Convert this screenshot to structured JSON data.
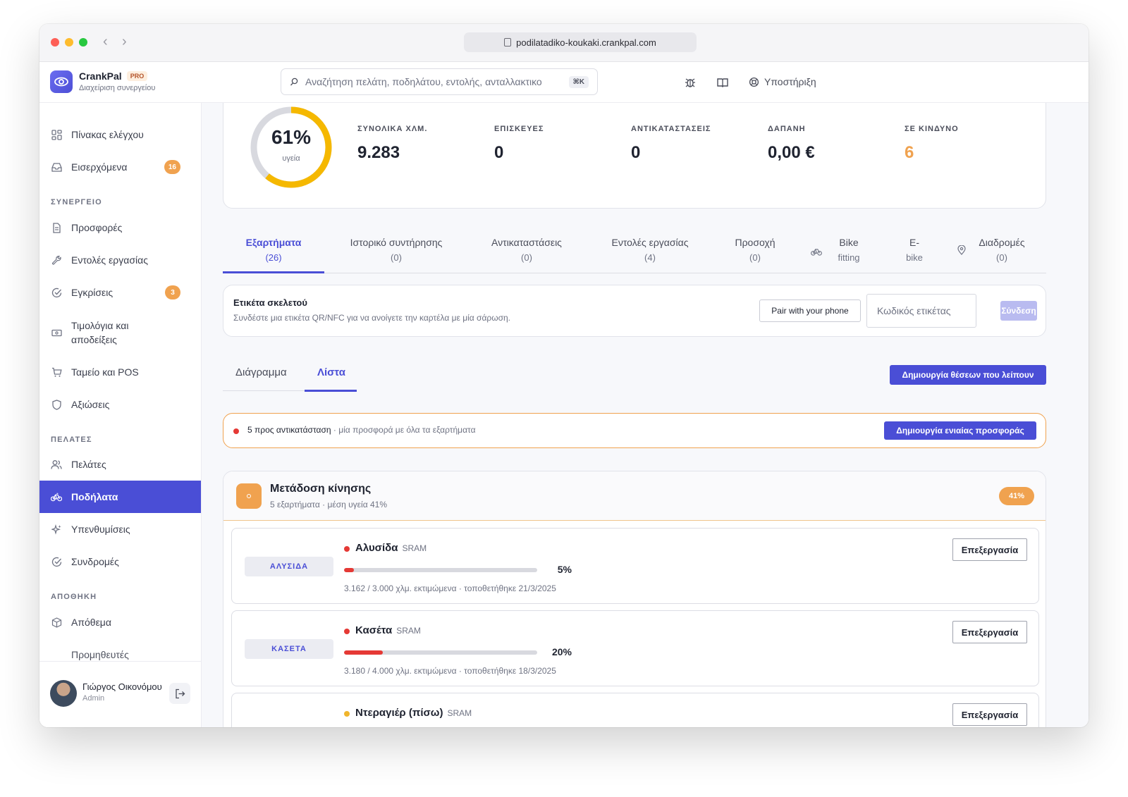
{
  "browser": {
    "url": "podilatadiko-koukaki.crankpal.com"
  },
  "app": {
    "name": "CrankPal",
    "badge": "PRO",
    "subtitle": "Διαχείριση συνεργείου"
  },
  "search": {
    "placeholder": "Αναζήτηση πελάτη, ποδηλάτου, εντολής, ανταλλακτικο",
    "shortcut": "⌘K"
  },
  "topbar": {
    "support_label": "Υποστήριξη"
  },
  "sidebar": {
    "dashboard": "Πίνακας ελέγχου",
    "inbox": "Εισερχόμενα",
    "inbox_count": "16",
    "section_workshop": "ΣΥΝΕΡΓΕΙΟ",
    "offers": "Προσφορές",
    "work_orders": "Εντολές εργασίας",
    "approvals": "Εγκρίσεις",
    "approvals_count": "3",
    "invoices": "Τιμολόγια και αποδείξεις",
    "pos": "Ταμείο και POS",
    "claims": "Αξιώσεις",
    "section_customers": "ΠΕΛΑΤΕΣ",
    "customers": "Πελάτες",
    "bikes": "Ποδήλατα",
    "reminders": "Υπενθυμίσεις",
    "subscriptions": "Συνδρομές",
    "section_storage": "ΑΠΟΘΗΚΗ",
    "stock": "Απόθεμα",
    "cut_off_item": "Προμηθευτές"
  },
  "user": {
    "name": "Γιώργος Οικονόμου",
    "role": "Admin"
  },
  "stats": {
    "health_pct": "61%",
    "health_value": 0.61,
    "health_label": "υγεία",
    "total_km_label": "ΣΥΝΟΛΙΚΑ ΧΛΜ.",
    "total_km": "9.283",
    "repairs_label": "ΕΠΙΣΚΕΥΕΣ",
    "repairs": "0",
    "replacements_label": "ΑΝΤΙΚΑΤΑΣΤΑΣΕΙΣ",
    "replacements": "0",
    "cost_label": "ΔΑΠΑΝΗ",
    "cost": "0,00 €",
    "risk_label": "ΣΕ ΚΙΝΔΥΝΟ",
    "risk": "6"
  },
  "tabs": {
    "components": "Εξαρτήματα",
    "components_count": "(26)",
    "history": "Ιστορικό συντήρησης",
    "history_count": "(0)",
    "replacements": "Αντικαταστάσεις",
    "replacements_count": "(0)",
    "work_orders": "Εντολές εργασίας",
    "work_orders_count": "(4)",
    "attention": "Προσοχή",
    "attention_count": "(0)",
    "bike_fitting_1": "Bike",
    "bike_fitting_2": "fitting",
    "ebike_1": "E-",
    "ebike_2": "bike",
    "routes": "Διαδρομές",
    "routes_count": "(0)"
  },
  "frame_tag": {
    "title": "Ετικέτα σκελετού",
    "description": "Συνδέστε μια ετικέτα QR/NFC για να ανοίγετε την καρτέλα με μία σάρωση.",
    "pair_button": "Pair with your phone",
    "input_placeholder": "Κωδικός ετικέτας",
    "connect_button": "Σύνδεση"
  },
  "view": {
    "diagram": "Διάγραμμα",
    "list": "Λίστα",
    "create_slots": "Δημιουργία θέσεων που λείπουν"
  },
  "alert": {
    "main": "5 προς αντικατάσταση",
    "sub": " · μία προσφορά με όλα τα εξαρτήματα",
    "button": "Δημιουργία ενιαίας προσφοράς"
  },
  "group": {
    "title": "Μετάδοση κίνησης",
    "subtitle": "5 εξαρτήματα · μέση υγεία 41%",
    "pill": "41%",
    "components": [
      {
        "code": "ΑΛΥΣΙΔΑ",
        "name": "Αλυσίδα",
        "brand": "SRAM",
        "health": 0.05,
        "pct": "5%",
        "meta": "3.162 / 3.000 χλμ. εκτιμώμενα · τοποθετήθηκε 21/3/2025",
        "edit": "Επεξεργασία"
      },
      {
        "code": "ΚΑΣΕΤΑ",
        "name": "Κασέτα",
        "brand": "SRAM",
        "health": 0.2,
        "pct": "20%",
        "meta": "3.180 / 4.000 χλμ. εκτιμώμενα · τοποθετήθηκε 18/3/2025",
        "edit": "Επεξεργασία"
      },
      {
        "name": "Ντεραγιέρ (πίσω)",
        "brand": "SRAM",
        "edit": "Επεξεργασία"
      }
    ]
  },
  "colors": {
    "accent": "#4a4ed6",
    "warning": "#f0a24f",
    "danger": "#e53935",
    "ring_track": "#d8d9df",
    "ring_fill": "#f5b800"
  }
}
